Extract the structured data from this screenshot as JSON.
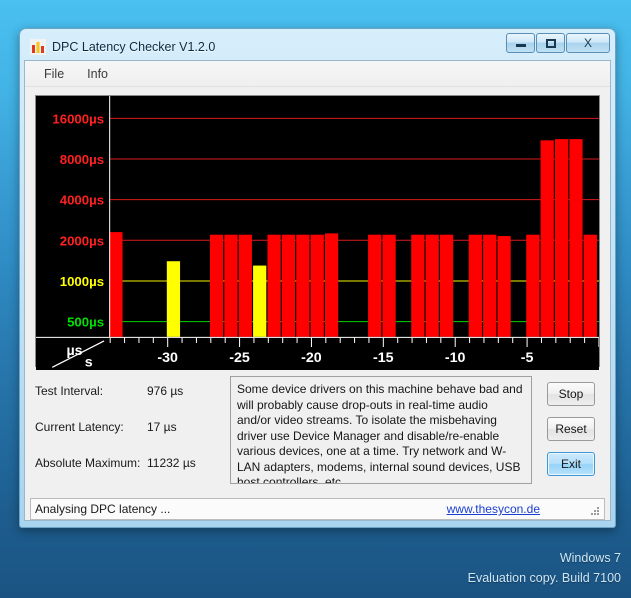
{
  "desktop": {
    "watermark_line1": "Windows 7",
    "watermark_line2": "Evaluation copy. Build 7100"
  },
  "window": {
    "title": "DPC Latency Checker V1.2.0",
    "icon": "bar-chart-icon",
    "buttons": {
      "minimize": "minimize-icon",
      "maximize": "maximize-icon",
      "close": "X"
    }
  },
  "menubar": {
    "items": [
      {
        "label": "File"
      },
      {
        "label": "Info"
      }
    ]
  },
  "stats": {
    "rows": [
      {
        "label": "Test Interval:",
        "value": "976 µs"
      },
      {
        "label": "Current Latency:",
        "value": "17 µs"
      },
      {
        "label": "Absolute Maximum:",
        "value": "11232 µs"
      }
    ]
  },
  "description": "Some device drivers on this machine behave bad and will probably cause drop-outs in real-time audio and/or video streams. To isolate the misbehaving driver use Device Manager and disable/re-enable various devices, one at a time. Try network and W-LAN adapters, modems, internal sound devices, USB host controllers, etc.",
  "buttons": {
    "stop": "Stop",
    "reset": "Reset",
    "exit": "Exit"
  },
  "statusbar": {
    "text": "Analysing DPC latency ...",
    "link": "www.thesycon.de"
  },
  "chart_data": {
    "type": "bar",
    "title": "",
    "xlabel": "s",
    "ylabel": "µs",
    "corner_label_top": "µs",
    "corner_label_bottom": "s",
    "grid": true,
    "ylim": [
      0,
      17000
    ],
    "yscale": "log-like-banded",
    "ytick_labels": [
      "16000µs",
      "8000µs",
      "4000µs",
      "2000µs",
      "1000µs",
      "500µs"
    ],
    "ytick_values": [
      16000,
      8000,
      4000,
      2000,
      1000,
      500
    ],
    "ytick_colors": [
      "#ff2020",
      "#ff2020",
      "#ff2020",
      "#ff2020",
      "#ffff00",
      "#00e000"
    ],
    "xlim": [
      -34,
      0
    ],
    "xtick_labels": [
      "-30",
      "-25",
      "-20",
      "-15",
      "-10",
      "-5"
    ],
    "xtick_values": [
      -30,
      -25,
      -20,
      -15,
      -10,
      -5
    ],
    "series_colors": {
      "red": "#ff0000",
      "yellow": "#ffff00",
      "green": "#00e000"
    },
    "bars": [
      {
        "x": -33.6,
        "value": 2300,
        "color": "red"
      },
      {
        "x": -32.6,
        "value": 120,
        "color": "green"
      },
      {
        "x": -31.6,
        "value": 220,
        "color": "green"
      },
      {
        "x": -30.6,
        "value": 220,
        "color": "green"
      },
      {
        "x": -29.6,
        "value": 1400,
        "color": "yellow"
      },
      {
        "x": -28.6,
        "value": 200,
        "color": "green"
      },
      {
        "x": -27.6,
        "value": 210,
        "color": "green"
      },
      {
        "x": -26.6,
        "value": 2200,
        "color": "red"
      },
      {
        "x": -25.6,
        "value": 2200,
        "color": "red"
      },
      {
        "x": -24.6,
        "value": 2200,
        "color": "red"
      },
      {
        "x": -23.6,
        "value": 1300,
        "color": "yellow"
      },
      {
        "x": -22.6,
        "value": 2200,
        "color": "red"
      },
      {
        "x": -21.6,
        "value": 2200,
        "color": "red"
      },
      {
        "x": -20.6,
        "value": 2200,
        "color": "red"
      },
      {
        "x": -19.6,
        "value": 2200,
        "color": "red"
      },
      {
        "x": -18.6,
        "value": 2250,
        "color": "red"
      },
      {
        "x": -17.6,
        "value": 180,
        "color": "green"
      },
      {
        "x": -16.6,
        "value": 130,
        "color": "green"
      },
      {
        "x": -15.6,
        "value": 2200,
        "color": "red"
      },
      {
        "x": -14.6,
        "value": 2200,
        "color": "red"
      },
      {
        "x": -13.6,
        "value": 140,
        "color": "green"
      },
      {
        "x": -12.6,
        "value": 2200,
        "color": "red"
      },
      {
        "x": -11.6,
        "value": 2200,
        "color": "red"
      },
      {
        "x": -10.6,
        "value": 2200,
        "color": "red"
      },
      {
        "x": -9.6,
        "value": 140,
        "color": "green"
      },
      {
        "x": -8.6,
        "value": 2200,
        "color": "red"
      },
      {
        "x": -7.6,
        "value": 2200,
        "color": "red"
      },
      {
        "x": -6.6,
        "value": 2150,
        "color": "red"
      },
      {
        "x": -5.6,
        "value": 170,
        "color": "green"
      },
      {
        "x": -4.6,
        "value": 2200,
        "color": "red"
      },
      {
        "x": -3.6,
        "value": 11000,
        "color": "red"
      },
      {
        "x": -2.6,
        "value": 11232,
        "color": "red"
      },
      {
        "x": -1.6,
        "value": 11232,
        "color": "red"
      },
      {
        "x": -0.6,
        "value": 2200,
        "color": "red"
      }
    ]
  }
}
